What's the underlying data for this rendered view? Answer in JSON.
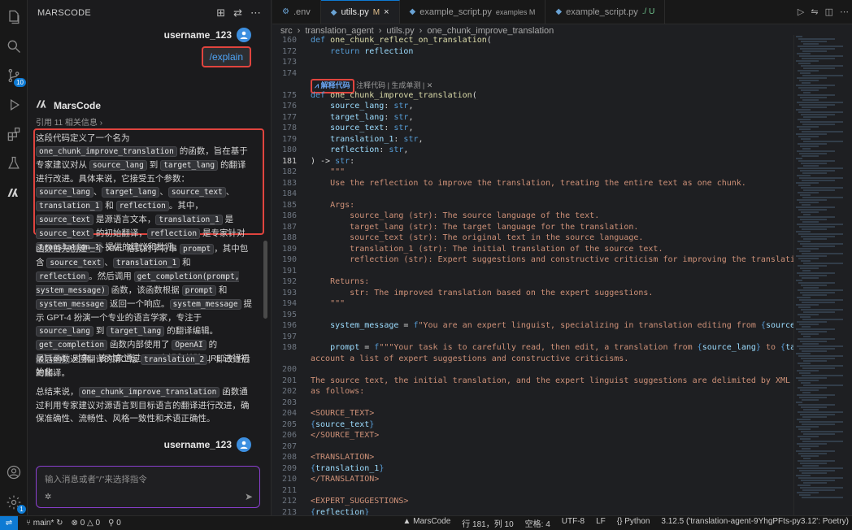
{
  "activity_bar": {
    "badges": {
      "source_control": "10",
      "settings": "1"
    }
  },
  "chat": {
    "title": "MARSCODE",
    "user_name": "username_123",
    "command": "/explain",
    "bot_name": "MarsCode",
    "refs": "引用 11 相关信息",
    "paragraphs": {
      "p1": [
        "这段代码定义了一个名为 ",
        "one_chunk_improve_translation",
        " 的函数，旨在基于专家建议对从 ",
        "source_lang",
        " 到 ",
        "target_lang",
        " 的翻译进行改进。具体来说，它接受五个参数：",
        "source_lang",
        "、",
        "target_lang",
        "、",
        "source_text",
        "、",
        "translation_1",
        " 和 ",
        "reflection",
        "。其中，",
        "source_text",
        " 是源语言文本，",
        "translation_1",
        " 是 ",
        "source_text",
        " 的初始翻译，",
        "reflection",
        " 是专家针对 ",
        "translation_1",
        " 提供的建议和批评。"
      ],
      "p2": [
        "函数首先创建一个 XML 格式的字符串 ",
        "prompt",
        "，其中包含 ",
        "source_text",
        "、",
        "translation_1",
        " 和 ",
        "reflection",
        "。然后调用 ",
        "get_completion(prompt, system_message)",
        " 函数，该函数根据 ",
        "prompt",
        " 和 ",
        "system_message",
        " 返回一个响应。",
        "system_message",
        " 提示 GPT-4 扮演一个专业的语言学家，专注于 ",
        "source_lang",
        " 到 ",
        "target_lang",
        " 的翻译编辑。",
        "get_completion",
        " 函数内部使用了 ",
        "OpenAI",
        " 的 ",
        "client",
        " 对象，该对象通过 API 密钥和基础 URL 进行初始化。"
      ],
      "p3": [
        "最后函数返回翻译的第二版 ",
        "translation_2",
        "，即改进后的翻译。"
      ],
      "p4": [
        "总结来说，",
        "one_chunk_improve_translation",
        " 函数通过利用专家建议对源语言到目标语言的翻译进行改进，确保准确性、流畅性、风格一致性和术语正确性。"
      ]
    },
    "input_placeholder": "输入消息或者\"/\"来选择指令"
  },
  "tabs": [
    {
      "label": ".env",
      "icon": "gear-icon",
      "suffix": "",
      "active": false
    },
    {
      "label": "utils.py",
      "icon": "python-icon",
      "suffix": "M",
      "active": true
    },
    {
      "label": "example_script.py",
      "icon": "python-icon",
      "suffix": "examples M",
      "active": false
    },
    {
      "label": "example_script.py",
      "icon": "python-icon",
      "suffix": "./ U",
      "active": false
    }
  ],
  "breadcrumb": [
    "src",
    "translation_agent",
    "utils.py",
    "one_chunk_improve_translation"
  ],
  "codelens": {
    "tag": "解释代码",
    "rest": "注释代码 | 生成单测 | ✕"
  },
  "code_lines": [
    {
      "n": "160",
      "html": "<span class='kw'>def</span> <span class='fn'>one_chunk_reflect_on_translation</span><span class='plain'>(</span>"
    },
    {
      "n": "172",
      "html": "    <span class='kw'>return</span> <span class='var'>reflection</span>"
    },
    {
      "n": "173",
      "html": ""
    },
    {
      "n": "174",
      "html": ""
    },
    {
      "n": "lens",
      "html": ""
    },
    {
      "n": "175",
      "html": "<span class='kw'>def</span> <span class='fn'>one_chunk_improve_translation</span><span class='plain'>(</span>"
    },
    {
      "n": "176",
      "html": "    <span class='var'>source_lang</span><span class='plain'>: </span><span class='kw'>str</span><span class='plain'>,</span>"
    },
    {
      "n": "177",
      "html": "    <span class='var'>target_lang</span><span class='plain'>: </span><span class='kw'>str</span><span class='plain'>,</span>"
    },
    {
      "n": "178",
      "html": "    <span class='var'>source_text</span><span class='plain'>: </span><span class='kw'>str</span><span class='plain'>,</span>"
    },
    {
      "n": "179",
      "html": "    <span class='var'>translation_1</span><span class='plain'>: </span><span class='kw'>str</span><span class='plain'>,</span>"
    },
    {
      "n": "180",
      "html": "    <span class='var'>reflection</span><span class='plain'>: </span><span class='kw'>str</span><span class='plain'>,</span>"
    },
    {
      "n": "181",
      "html": "<span class='plain'>) -&gt; </span><span class='kw'>str</span><span class='plain'>:</span>"
    },
    {
      "n": "182",
      "html": "    <span class='str'>\"\"\"</span>"
    },
    {
      "n": "183",
      "html": "<span class='str'>    Use the reflection to improve the translation, treating the entire text as one chunk.</span>"
    },
    {
      "n": "184",
      "html": ""
    },
    {
      "n": "185",
      "html": "<span class='str'>    Args:</span>"
    },
    {
      "n": "186",
      "html": "<span class='str'>        source_lang (str): The source language of the text.</span>"
    },
    {
      "n": "187",
      "html": "<span class='str'>        target_lang (str): The target language for the translation.</span>"
    },
    {
      "n": "188",
      "html": "<span class='str'>        source_text (str): The original text in the source language.</span>"
    },
    {
      "n": "189",
      "html": "<span class='str'>        translation_1 (str): The initial translation of the source text.</span>"
    },
    {
      "n": "190",
      "html": "<span class='str'>        reflection (str): Expert suggestions and constructive criticism for improving the translation.</span>"
    },
    {
      "n": "191",
      "html": ""
    },
    {
      "n": "192",
      "html": "<span class='str'>    Returns:</span>"
    },
    {
      "n": "193",
      "html": "<span class='str'>        str: The improved translation based on the expert suggestions.</span>"
    },
    {
      "n": "194",
      "html": "<span class='str'>    \"\"\"</span>"
    },
    {
      "n": "195",
      "html": ""
    },
    {
      "n": "196",
      "html": "    <span class='var'>system_message</span><span class='plain'> = </span><span class='kw'>f</span><span class='str'>\"You are an expert linguist, specializing in translation editing from </span><span class='interp'>{</span><span class='interp-var'>source_lang</span><span class='interp'>}</span><span class='str'> to </span><span class='interp'>{</span>"
    },
    {
      "n": "197",
      "html": ""
    },
    {
      "n": "198",
      "html": "    <span class='var'>prompt</span><span class='plain'> = </span><span class='kw'>f</span><span class='str'>\"\"\"Your task is to carefully read, then edit, a translation from </span><span class='interp'>{</span><span class='interp-var'>source_lang</span><span class='interp'>}</span><span class='str'> to </span><span class='interp'>{</span><span class='interp-var'>target_lang</span><span class='interp'>}</span><span class='str'>,</span>"
    },
    {
      "n": "",
      "html": "<span class='str'>account a list of expert suggestions and constructive criticisms.</span>"
    },
    {
      "n": "200",
      "html": ""
    },
    {
      "n": "201",
      "html": "<span class='str'>The source text, the initial translation, and the expert linguist suggestions are delimited by XML tags &lt;SOURC</span>"
    },
    {
      "n": "202",
      "html": "<span class='str'>as follows:</span>"
    },
    {
      "n": "203",
      "html": ""
    },
    {
      "n": "204",
      "html": "<span class='str'>&lt;SOURCE_TEXT&gt;</span>"
    },
    {
      "n": "205",
      "html": "<span class='interp'>{</span><span class='interp-var'>source_text</span><span class='interp'>}</span>"
    },
    {
      "n": "206",
      "html": "<span class='str'>&lt;/SOURCE_TEXT&gt;</span>"
    },
    {
      "n": "207",
      "html": ""
    },
    {
      "n": "208",
      "html": "<span class='str'>&lt;TRANSLATION&gt;</span>"
    },
    {
      "n": "209",
      "html": "<span class='interp'>{</span><span class='interp-var'>translation_1</span><span class='interp'>}</span>"
    },
    {
      "n": "210",
      "html": "<span class='str'>&lt;/TRANSLATION&gt;</span>"
    },
    {
      "n": "211",
      "html": ""
    },
    {
      "n": "212",
      "html": "<span class='str'>&lt;EXPERT_SUGGESTIONS&gt;</span>"
    },
    {
      "n": "213",
      "html": "<span class='interp'>{</span><span class='interp-var'>reflection</span><span class='interp'>}</span>"
    }
  ],
  "current_line": "181",
  "status_bar": {
    "branch": "main*",
    "errors": "0",
    "warnings": "0",
    "ports": "0",
    "marscode": "MarsCode",
    "position": "行 181，列 10",
    "spaces": "空格: 4",
    "encoding": "UTF-8",
    "eol": "LF",
    "language": "Python",
    "interpreter": "3.12.5 ('translation-agent-9YhgPFts-py3.12': Poetry)"
  }
}
